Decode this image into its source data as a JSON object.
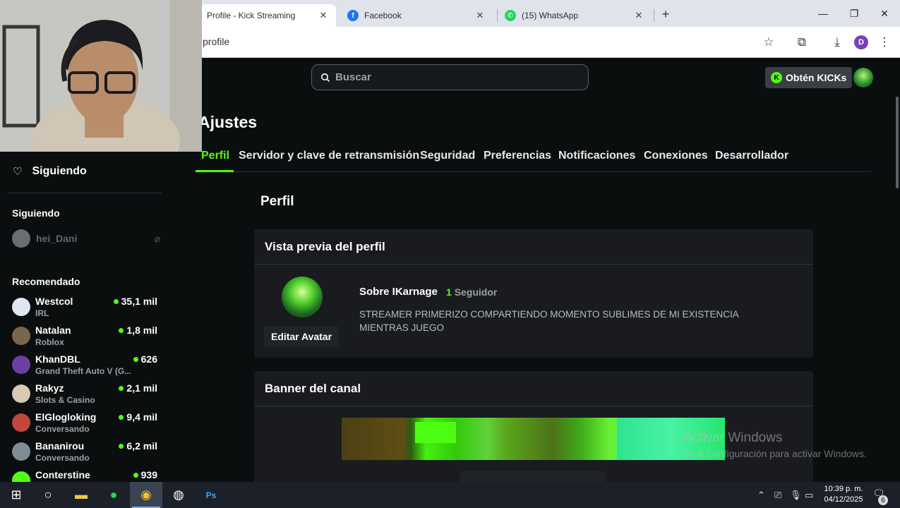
{
  "browser": {
    "tabs": [
      {
        "title": "Profile - Kick Streaming",
        "active": true
      },
      {
        "title": "Facebook",
        "active": false
      },
      {
        "title": "(15) WhatsApp",
        "active": false
      }
    ],
    "url": "profile",
    "profile_initial": "D"
  },
  "header": {
    "search_placeholder": "Buscar",
    "get_kicks": "Obtén KICKs"
  },
  "settings": {
    "title": "Ajustes",
    "tabs": [
      "Perfil",
      "Servidor y clave de retransmisión",
      "Seguridad",
      "Preferencias",
      "Notificaciones",
      "Conexiones",
      "Desarrollador"
    ],
    "section_title": "Perfil"
  },
  "profile_preview": {
    "card_title": "Vista previa del perfil",
    "edit_avatar": "Editar Avatar",
    "about_name": "Sobre IKarnage",
    "follower_count": "1",
    "follower_label": "Seguidor",
    "bio": "STREAMER PRIMERIZO COMPARTIENDO MOMENTO SUBLIMES DE MI EXISTENCIA MIENTRAS JUEGO"
  },
  "banner": {
    "card_title": "Banner del canal"
  },
  "sidebar": {
    "following_nav": "Siguiendo",
    "following_header": "Siguiendo",
    "followed": [
      {
        "name": "hei_Dani"
      }
    ],
    "recommended_header": "Recomendado",
    "recommended": [
      {
        "name": "Westcol",
        "category": "IRL",
        "viewers": "35,1 mil",
        "color": "#dfe7ef"
      },
      {
        "name": "Natalan",
        "category": "Roblox",
        "viewers": "1,8 mil",
        "color": "#7a6550"
      },
      {
        "name": "KhanDBL",
        "category": "Grand Theft Auto V (G...",
        "viewers": "626",
        "color": "#6b3fa3"
      },
      {
        "name": "Rakyz",
        "category": "Slots & Casino",
        "viewers": "2,1 mil",
        "color": "#d9c9b5"
      },
      {
        "name": "ElGlogloking",
        "category": "Conversando",
        "viewers": "9,4 mil",
        "color": "#c1463c"
      },
      {
        "name": "Bananirou",
        "category": "Conversando",
        "viewers": "6,2 mil",
        "color": "#7f8b95"
      },
      {
        "name": "Conterstine",
        "category": "",
        "viewers": "939",
        "color": "#53fc18"
      }
    ]
  },
  "watermark": {
    "line1": "Activar Windows",
    "line2": "Ve a Configuración para activar Windows."
  },
  "taskbar": {
    "time": "10:39 p. m.",
    "date": "04/12/2025",
    "notifications": "6"
  }
}
